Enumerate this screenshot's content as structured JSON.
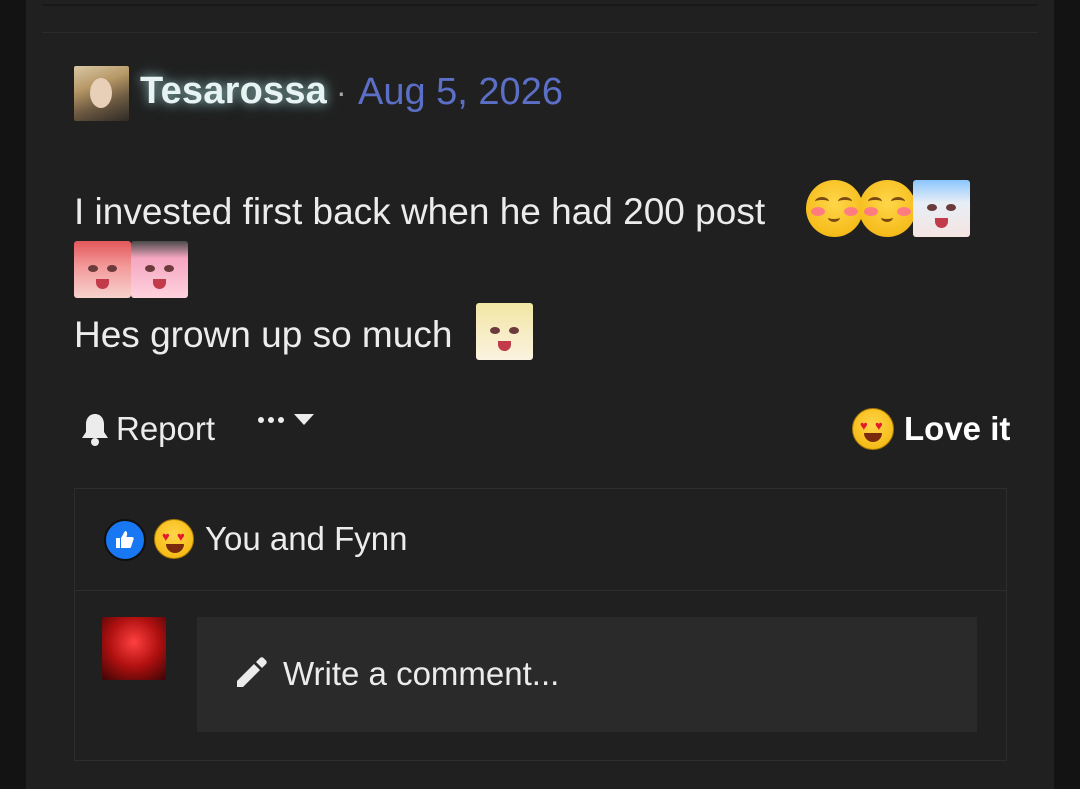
{
  "post": {
    "username": "Tesarossa",
    "separator": "·",
    "date": "Aug 5, 2026",
    "line1": "I invested first back when he had 200 post",
    "line3": "Hes grown up so much"
  },
  "actions": {
    "report_label": "Report",
    "reaction_label": "Love it"
  },
  "reactions": {
    "summary": "You and Fynn"
  },
  "comment": {
    "placeholder": "Write a comment..."
  },
  "colors": {
    "background": "#202020",
    "date_link": "#5b6fc6",
    "like_blue": "#1877f2"
  },
  "icons": [
    "bell-icon",
    "more-dots-icon",
    "caret-down-icon",
    "heart-eyes-emoji-icon",
    "thumbs-up-icon",
    "pencil-icon"
  ]
}
